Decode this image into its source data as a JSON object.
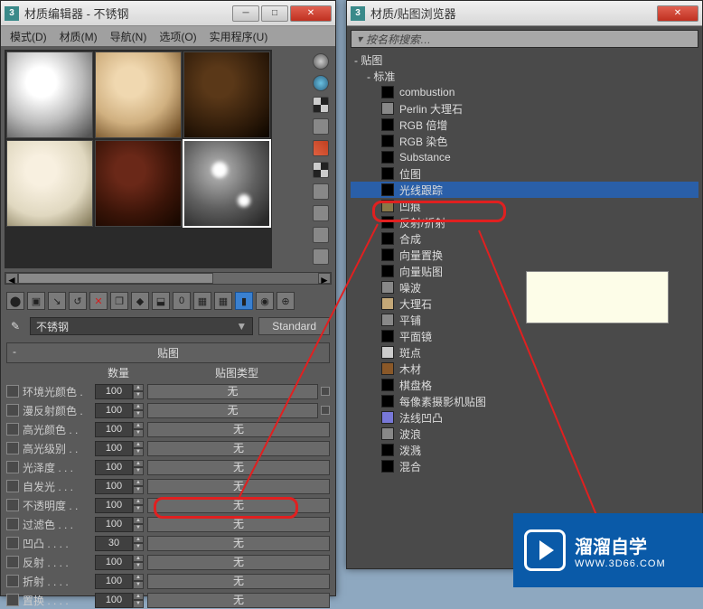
{
  "editor": {
    "title": "材质编辑器 - 不锈钢",
    "menus": [
      "模式(D)",
      "材质(M)",
      "导航(N)",
      "选项(O)",
      "实用程序(U)"
    ],
    "material_name": "不锈钢",
    "type_button": "Standard",
    "section_header": "贴图",
    "col_amount": "数量",
    "col_type": "贴图类型",
    "rows": [
      {
        "label": "环境光颜色 .",
        "amount": "100",
        "slot": "无"
      },
      {
        "label": "漫反射颜色 .",
        "amount": "100",
        "slot": "无"
      },
      {
        "label": "高光颜色 . .",
        "amount": "100",
        "slot": "无"
      },
      {
        "label": "高光级别 . .",
        "amount": "100",
        "slot": "无"
      },
      {
        "label": "光泽度 . . .",
        "amount": "100",
        "slot": "无"
      },
      {
        "label": "自发光 . . .",
        "amount": "100",
        "slot": "无"
      },
      {
        "label": "不透明度 . .",
        "amount": "100",
        "slot": "无"
      },
      {
        "label": "过滤色 . . .",
        "amount": "100",
        "slot": "无"
      },
      {
        "label": "凹凸 . . . .",
        "amount": "30",
        "slot": "无"
      },
      {
        "label": "反射 . . . .",
        "amount": "100",
        "slot": "无"
      },
      {
        "label": "折射 . . . .",
        "amount": "100",
        "slot": "无"
      },
      {
        "label": "置换 . . . .",
        "amount": "100",
        "slot": "无"
      }
    ]
  },
  "browser": {
    "title": "材质/贴图浏览器",
    "search_placeholder": "按名称搜索…",
    "root": "- 贴图",
    "sub": "- 标准",
    "items": [
      {
        "label": "combustion",
        "sw": "#000"
      },
      {
        "label": "Perlin 大理石",
        "sw": "#888"
      },
      {
        "label": "RGB 倍增",
        "sw": "#000"
      },
      {
        "label": "RGB 染色",
        "sw": "#000"
      },
      {
        "label": "Substance",
        "sw": "#000"
      },
      {
        "label": "位图",
        "sw": "#000"
      },
      {
        "label": "光线跟踪",
        "sw": "#000",
        "selected": true
      },
      {
        "label": "凹痕",
        "sw": "#8a7848"
      },
      {
        "label": "反射/折射",
        "sw": "#000"
      },
      {
        "label": "合成",
        "sw": "#000"
      },
      {
        "label": "向量置换",
        "sw": "#000"
      },
      {
        "label": "向量贴图",
        "sw": "#000"
      },
      {
        "label": "噪波",
        "sw": "#888"
      },
      {
        "label": "大理石",
        "sw": "#c4a878"
      },
      {
        "label": "平铺",
        "sw": "#888"
      },
      {
        "label": "平面镜",
        "sw": "#000"
      },
      {
        "label": "斑点",
        "sw": "#ccc"
      },
      {
        "label": "木材",
        "sw": "#8a5828"
      },
      {
        "label": "棋盘格",
        "sw": "#000"
      },
      {
        "label": "每像素摄影机贴图",
        "sw": "#000"
      },
      {
        "label": "法线凹凸",
        "sw": "#7878d8"
      },
      {
        "label": "波浪",
        "sw": "#888"
      },
      {
        "label": "泼溅",
        "sw": "#000"
      },
      {
        "label": "混合",
        "sw": "#000"
      }
    ]
  },
  "watermark": {
    "main": "溜溜自学",
    "sub": "WWW.3D66.COM"
  }
}
